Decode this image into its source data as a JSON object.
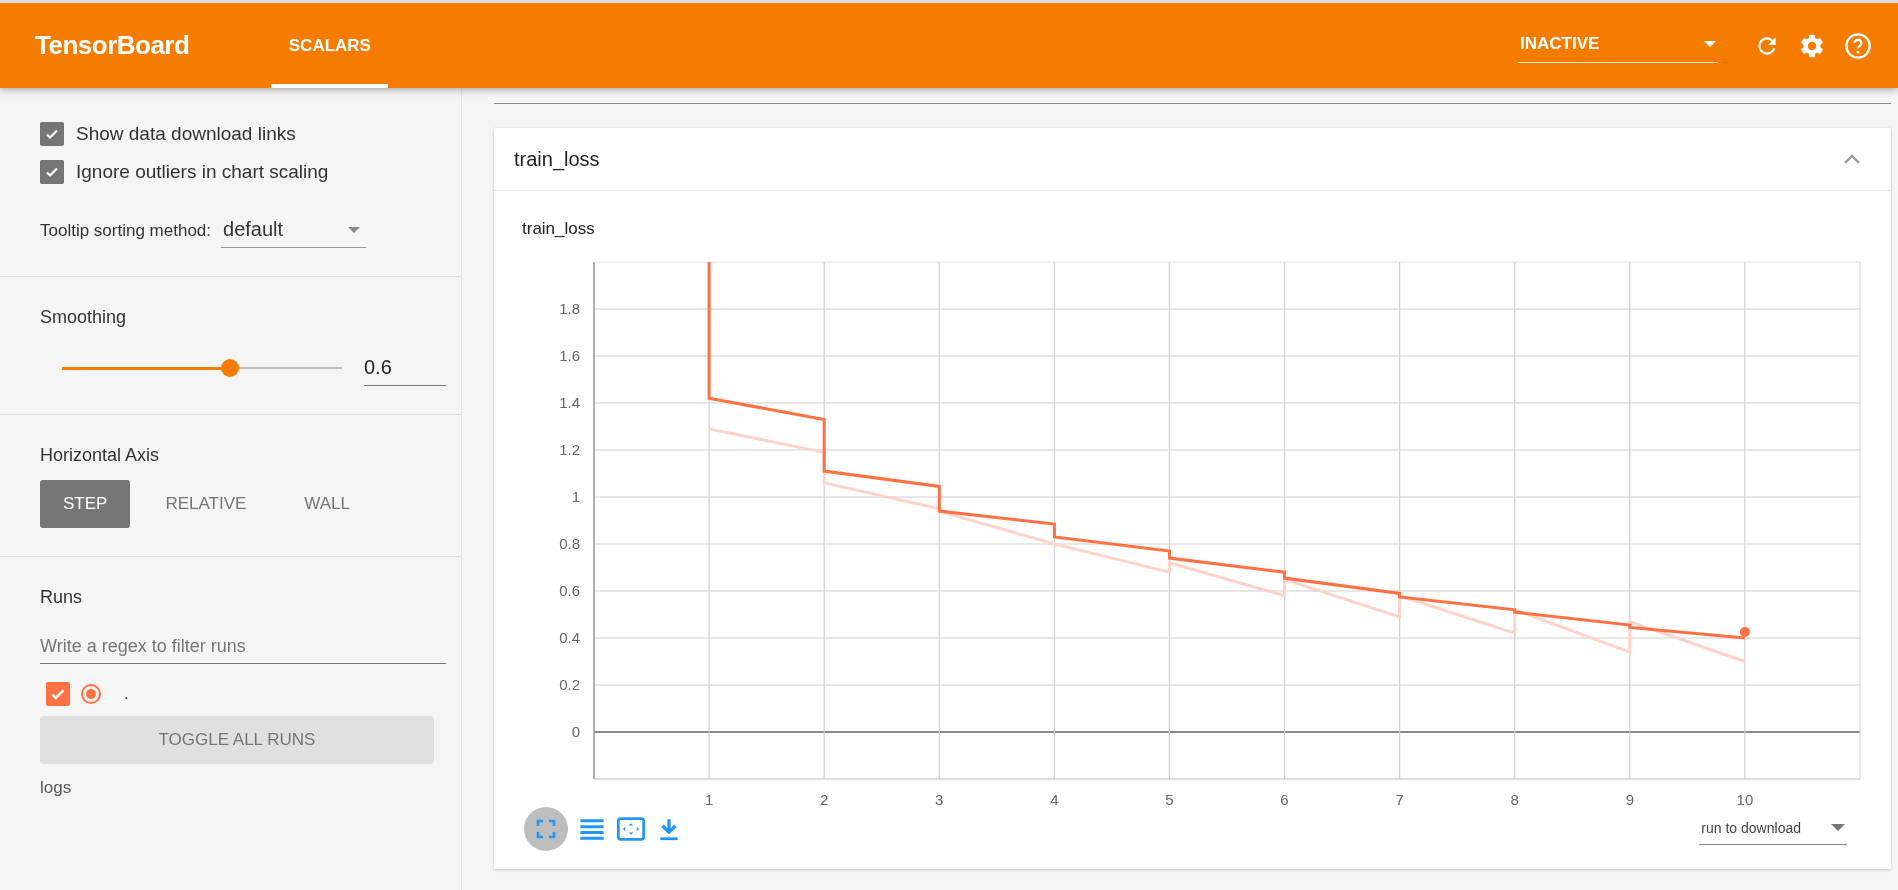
{
  "header": {
    "title": "TensorBoard",
    "tabs": [
      {
        "label": "SCALARS",
        "selected": true
      }
    ],
    "run_status": {
      "value": "INACTIVE"
    }
  },
  "sidebar": {
    "options": [
      {
        "label": "Show data download links",
        "checked": true
      },
      {
        "label": "Ignore outliers in chart scaling",
        "checked": true
      }
    ],
    "tooltip_sorting": {
      "label": "Tooltip sorting method:",
      "value": "default"
    },
    "smoothing": {
      "title": "Smoothing",
      "level": 0.6,
      "value": "0.6"
    },
    "horizontal_axis": {
      "title": "Horizontal Axis",
      "options": [
        {
          "label": "STEP",
          "selected": true
        },
        {
          "label": "RELATIVE",
          "selected": false
        },
        {
          "label": "WALL",
          "selected": false
        }
      ]
    },
    "runs": {
      "title": "Runs",
      "filter": {
        "placeholder": "Write a regex to filter runs"
      },
      "items": [
        {
          "label": ".",
          "checked": true,
          "color": "#ff7043"
        }
      ],
      "toggle_button": "TOGGLE ALL RUNS",
      "footer": "logs"
    }
  },
  "main": {
    "card": {
      "title": "train_loss",
      "expanded": true,
      "chart_title": "train_loss",
      "chart_data": {
        "type": "line",
        "grid": true,
        "x": [
          1,
          1,
          2,
          2,
          3,
          3,
          4,
          4,
          5,
          5,
          6,
          6,
          7,
          7,
          8,
          8,
          9,
          9,
          10
        ],
        "xlim": [
          0,
          11
        ],
        "ylim": [
          -0.2,
          2.0
        ],
        "xticks": [
          1,
          2,
          3,
          4,
          5,
          6,
          7,
          8,
          9,
          10
        ],
        "yticks": [
          0,
          0.2,
          0.4,
          0.6,
          0.8,
          1,
          1.2,
          1.4,
          1.6,
          1.8
        ],
        "series": [
          {
            "color": "#ffd3c7",
            "values": [
              null,
              1.29,
              1.19,
              1.06,
              0.95,
              0.94,
              0.8,
              0.8,
              0.68,
              0.72,
              0.58,
              0.65,
              0.49,
              0.58,
              0.42,
              0.52,
              0.34,
              0.47,
              0.3
            ]
          },
          {
            "color": "#ff7043",
            "values": [
              2.0,
              1.42,
              1.33,
              1.11,
              1.045,
              0.94,
              0.885,
              0.83,
              0.77,
              0.74,
              0.68,
              0.655,
              0.59,
              0.575,
              0.52,
              0.51,
              0.455,
              0.445,
              0.4
            ]
          }
        ]
      },
      "download": {
        "placeholder": "run to download"
      }
    }
  }
}
